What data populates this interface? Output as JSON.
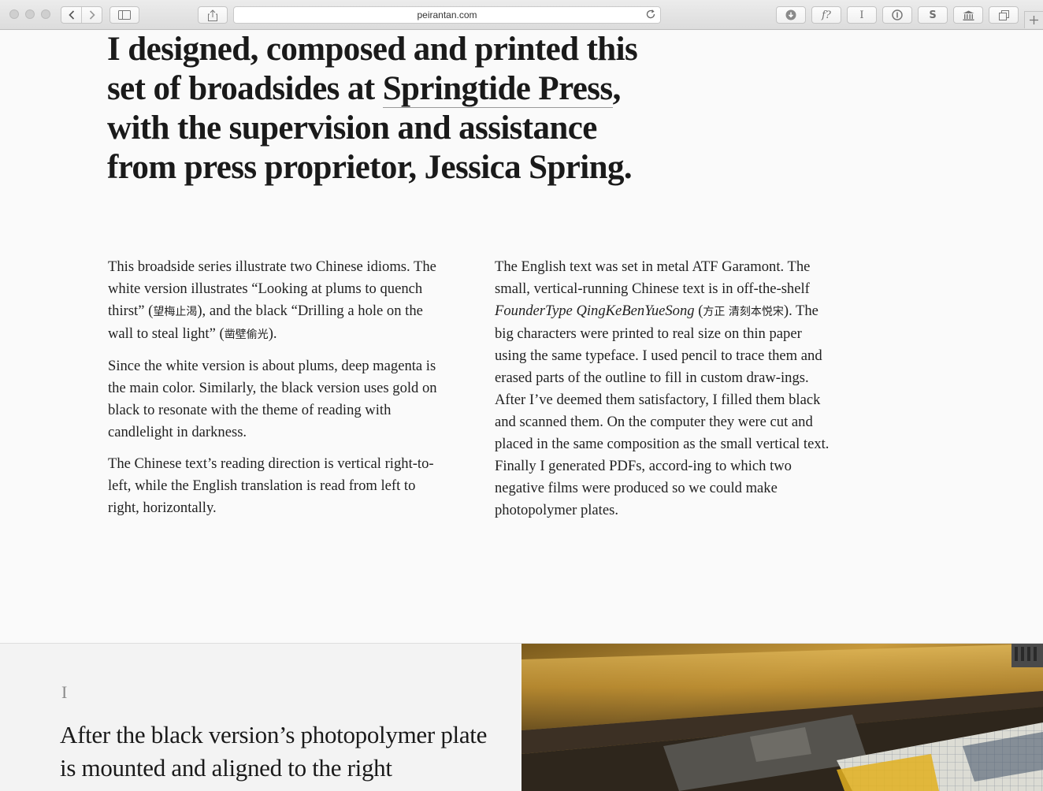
{
  "browser": {
    "url": "peirantan.com",
    "reload_icon": "reload-icon",
    "toolbar_icons": [
      "download-icon",
      "font-icon",
      "cursor-icon",
      "info-icon",
      "s-icon",
      "library-icon",
      "tabs-icon"
    ],
    "font_button_label": "f?",
    "cursor_button_label": "I",
    "s_button_label": "S"
  },
  "headline": {
    "part1": "I designed, composed and printed this set of broadsides at ",
    "link": "Springtide Press",
    "part2": ", with the supervision and assistance from press proprietor, Jessica Spring."
  },
  "left_column": {
    "p1_a": "This broadside series illustrate two Chinese idioms. The white version illustrates “Looking at plums to quench thirst” (",
    "p1_cjk1": "望梅止渴",
    "p1_b": "), and the black “Drilling a hole on the wall to steal light” (",
    "p1_cjk2": "凿壁偷光",
    "p1_c": ").",
    "p2": "Since the white version is about plums, deep magenta is the main color. Similarly, the black version uses gold on black to resonate with the theme of reading with candlelight in darkness.",
    "p3": "The Chinese text’s reading direction is vertical right-to-left, while the English translation is read from left to right, horizontally."
  },
  "right_column": {
    "a": "The English text was set in metal ATF Garamont. The small, vertical-running Chinese text is in off-the-shelf ",
    "italic": "FounderType QingKeBenYueSong",
    "b": " (",
    "cjk": "方正 清刻本悦宋",
    "c": "). The big characters were printed to real size on thin paper using the same typeface. I used pencil to trace them and erased parts of the outline to fill in custom draw-ings. After I’ve deemed them satisfactory, I filled them black and scanned them. On the computer they were cut and placed in the same composition as the small vertical text. Finally I generated PDFs, accord-ing to which two negative films were produced so we could make photopolymer plates."
  },
  "section": {
    "numeral": "I",
    "text": "After the black version’s photopolymer plate is mounted and aligned to the right"
  }
}
